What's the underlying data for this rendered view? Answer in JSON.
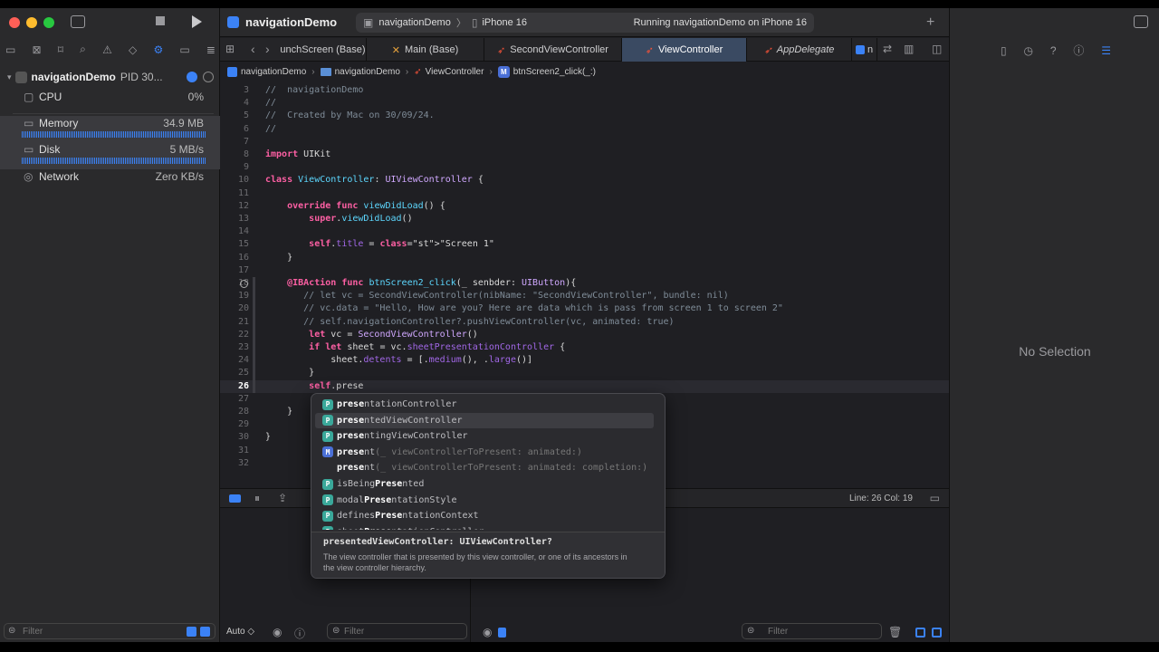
{
  "window": {
    "project": "navigationDemo",
    "scheme_target": "navigationDemo",
    "device": "iPhone 16",
    "status": "Running navigationDemo on iPhone 16"
  },
  "tabs": [
    {
      "label": "unchScreen (Base)",
      "icon": "xib-icon"
    },
    {
      "label": "Main (Base)",
      "icon": "xib-icon"
    },
    {
      "label": "SecondViewController",
      "icon": "swift-icon"
    },
    {
      "label": "ViewController",
      "icon": "swift-icon",
      "active": true
    },
    {
      "label": "AppDelegate",
      "icon": "swift-icon"
    },
    {
      "label": "n",
      "icon": "app-icon"
    }
  ],
  "breadcrumb": [
    "navigationDemo",
    "navigationDemo",
    "ViewController",
    "btnScreen2_click(_:)"
  ],
  "debug_navigator": {
    "process": "navigationDemo",
    "pid": "PID 30...",
    "gauges": [
      {
        "name": "CPU",
        "value": "0%"
      },
      {
        "name": "Memory",
        "value": "34.9 MB"
      },
      {
        "name": "Disk",
        "value": "5 MB/s"
      },
      {
        "name": "Network",
        "value": "Zero KB/s"
      }
    ],
    "filter_placeholder": "Filter"
  },
  "code": [
    {
      "n": "3",
      "t": "//  navigationDemo"
    },
    {
      "n": "4",
      "t": "//"
    },
    {
      "n": "5",
      "t": "//  Created by Mac on 30/09/24."
    },
    {
      "n": "6",
      "t": "//"
    },
    {
      "n": "7",
      "t": ""
    },
    {
      "n": "8",
      "t": "import UIKit"
    },
    {
      "n": "9",
      "t": ""
    },
    {
      "n": "10",
      "t": "class ViewController: UIViewController {"
    },
    {
      "n": "11",
      "t": ""
    },
    {
      "n": "12",
      "t": "    override func viewDidLoad() {"
    },
    {
      "n": "13",
      "t": "        super.viewDidLoad()"
    },
    {
      "n": "14",
      "t": ""
    },
    {
      "n": "15",
      "t": "        self.title = \"Screen 1\""
    },
    {
      "n": "16",
      "t": "    }"
    },
    {
      "n": "17",
      "t": ""
    },
    {
      "n": "18",
      "t": "    @IBAction func btnScreen2_click(_ senbder: UIButton){"
    },
    {
      "n": "19",
      "t": "       // let vc = SecondViewController(nibName: \"SecondViewController\", bundle: nil)"
    },
    {
      "n": "20",
      "t": "       // vc.data = \"Hello, How are you? Here are data which is pass from screen 1 to screen 2\""
    },
    {
      "n": "21",
      "t": "       // self.navigationController?.pushViewController(vc, animated: true)"
    },
    {
      "n": "22",
      "t": "        let vc = SecondViewController()"
    },
    {
      "n": "23",
      "t": "        if let sheet = vc.sheetPresentationController {"
    },
    {
      "n": "24",
      "t": "            sheet.detents = [.medium(), .large()]"
    },
    {
      "n": "25",
      "t": "        }"
    },
    {
      "n": "26",
      "t": "        self.prese"
    },
    {
      "n": "27",
      "t": ""
    },
    {
      "n": "28",
      "t": "    }"
    },
    {
      "n": "29",
      "t": ""
    },
    {
      "n": "30",
      "t": "}"
    },
    {
      "n": "31",
      "t": ""
    },
    {
      "n": "32",
      "t": ""
    }
  ],
  "autocomplete": {
    "items": [
      {
        "badge": "P",
        "prefix": "prese",
        "rest": "ntationController",
        "tail": ""
      },
      {
        "badge": "P",
        "prefix": "prese",
        "rest": "ntedViewController",
        "tail": "",
        "selected": true
      },
      {
        "badge": "P",
        "prefix": "prese",
        "rest": "ntingViewController",
        "tail": ""
      },
      {
        "badge": "M",
        "prefix": "prese",
        "rest": "nt",
        "tail": "(_ viewControllerToPresent: animated:)"
      },
      {
        "badge": "",
        "prefix": "prese",
        "rest": "nt",
        "tail": "(_ viewControllerToPresent: animated: completion:)"
      },
      {
        "badge": "P",
        "prefix": "isBeing",
        "rest": "Prese",
        "tail": "nted"
      },
      {
        "badge": "P",
        "prefix": "modal",
        "rest": "Prese",
        "tail": "ntationStyle"
      },
      {
        "badge": "P",
        "prefix": "defines",
        "rest": "Prese",
        "tail": "ntationContext"
      },
      {
        "badge": "P",
        "prefix": "sheet",
        "rest": "Prese",
        "tail": "ntationController"
      }
    ],
    "doc_signature": "presentedViewController: UIViewController?",
    "doc_text": "The view controller that is presented by this view controller, or one of its ancestors in the view controller hierarchy."
  },
  "status_bar": {
    "position": "Line: 26  Col: 19"
  },
  "debug_area": {
    "auto": "Auto ◇",
    "filter_placeholder": "Filter",
    "filter2_placeholder": "Filter"
  },
  "inspector": {
    "empty": "No Selection"
  }
}
